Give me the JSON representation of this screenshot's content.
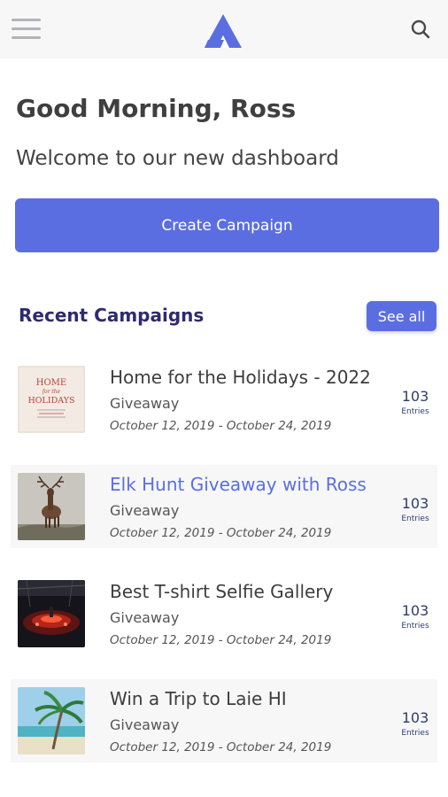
{
  "header": {
    "menu_icon": "hamburger-menu-icon",
    "logo_icon": "triangle-logo-icon",
    "search_icon": "search-icon",
    "accent_color": "#5b6ee1"
  },
  "greeting": "Good Morning, Ross",
  "welcome": "Welcome to our new dashboard",
  "create_button": "Create Campaign",
  "recent": {
    "title": "Recent Campaigns",
    "see_all": "See all"
  },
  "campaigns": [
    {
      "title": "Home for the Holidays - 2022",
      "type": "Giveaway",
      "dates": "October 12, 2019 - October 24, 2019",
      "count": "103",
      "entries_label": "Entries",
      "thumb_lines": [
        "HOME",
        "for the",
        "HOLIDAYS"
      ]
    },
    {
      "title": "Elk Hunt Giveaway with Ross",
      "type": "Giveaway",
      "dates": "October 12, 2019 - October 24, 2019",
      "count": "103",
      "entries_label": "Entries"
    },
    {
      "title": "Best T-shirt Selfie Gallery",
      "type": "Giveaway",
      "dates": "October 12, 2019 - October 24, 2019",
      "count": "103",
      "entries_label": "Entries"
    },
    {
      "title": "Win a Trip to Laie HI",
      "type": "Giveaway",
      "dates": "October 12, 2019 - October 24, 2019",
      "count": "103",
      "entries_label": "Entries"
    }
  ]
}
